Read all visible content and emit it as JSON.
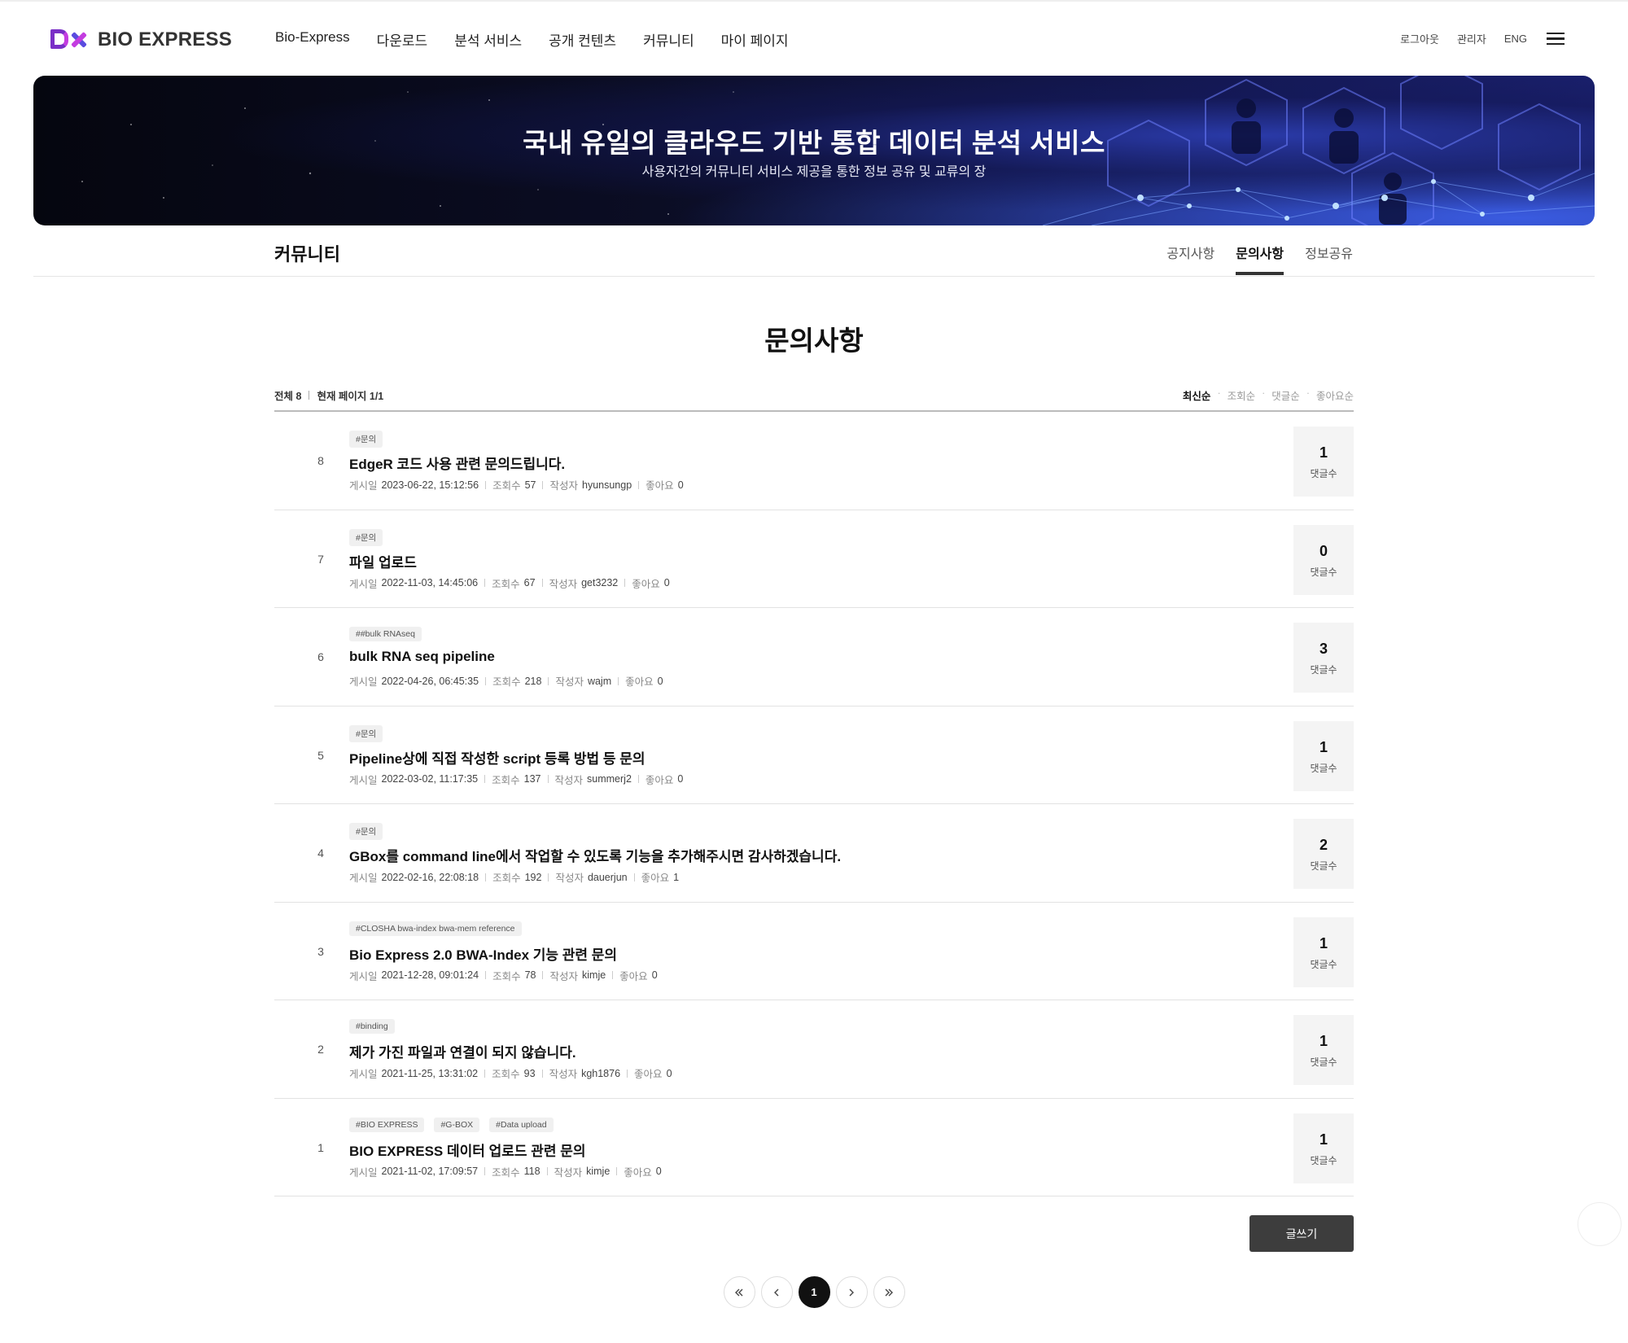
{
  "header": {
    "brand": "BIO EXPRESS",
    "nav": [
      "Bio-Express",
      "다운로드",
      "분석 서비스",
      "공개 컨텐츠",
      "커뮤니티",
      "마이 페이지"
    ],
    "util": [
      "로그아웃",
      "관리자",
      "ENG"
    ]
  },
  "banner": {
    "title": "국내 유일의 클라우드 기반 통합 데이터 분석 서비스",
    "subtitle": "사용자간의 커뮤니티 서비스 제공을 통한 정보 공유 및 교류의 장"
  },
  "subnav": {
    "title": "커뮤니티",
    "tabs": [
      "공지사항",
      "문의사항",
      "정보공유"
    ],
    "active_tab": "문의사항"
  },
  "board": {
    "title": "문의사항",
    "total_label": "전체 8",
    "page_label": "현재 페이지 1/1",
    "sort_options": [
      "최신순",
      "조회순",
      "댓글순",
      "좋아요순"
    ],
    "meta_labels": {
      "date": "게시일",
      "views": "조회수",
      "author": "작성자",
      "likes": "좋아요"
    },
    "comment_label": "댓글수",
    "posts": [
      {
        "num": "8",
        "tags": [
          "#문의"
        ],
        "title": "EdgeR 코드 사용 관련 문의드립니다.",
        "date": "2023-06-22, 15:12:56",
        "views": "57",
        "author": "hyunsungp",
        "likes": "0",
        "comments": "1"
      },
      {
        "num": "7",
        "tags": [
          "#문의"
        ],
        "title": "파일 업로드",
        "date": "2022-11-03, 14:45:06",
        "views": "67",
        "author": "get3232",
        "likes": "0",
        "comments": "0"
      },
      {
        "num": "6",
        "tags": [
          "##bulk RNAseq"
        ],
        "title": "bulk RNA seq pipeline",
        "date": "2022-04-26, 06:45:35",
        "views": "218",
        "author": "wajm",
        "likes": "0",
        "comments": "3"
      },
      {
        "num": "5",
        "tags": [
          "#문의"
        ],
        "title": "Pipeline상에 직접 작성한 script 등록 방법 등 문의",
        "date": "2022-03-02, 11:17:35",
        "views": "137",
        "author": "summerj2",
        "likes": "0",
        "comments": "1"
      },
      {
        "num": "4",
        "tags": [
          "#문의"
        ],
        "title": "GBox를 command line에서 작업할 수 있도록 기능을 추가해주시면 감사하겠습니다.",
        "date": "2022-02-16, 22:08:18",
        "views": "192",
        "author": "dauerjun",
        "likes": "1",
        "comments": "2"
      },
      {
        "num": "3",
        "tags": [
          "#CLOSHA bwa-index bwa-mem reference"
        ],
        "title": "Bio Express 2.0 BWA-Index 기능 관련 문의",
        "date": "2021-12-28, 09:01:24",
        "views": "78",
        "author": "kimje",
        "likes": "0",
        "comments": "1"
      },
      {
        "num": "2",
        "tags": [
          "#binding"
        ],
        "title": "제가 가진 파일과 연결이 되지 않습니다.",
        "date": "2021-11-25, 13:31:02",
        "views": "93",
        "author": "kgh1876",
        "likes": "0",
        "comments": "1"
      },
      {
        "num": "1",
        "tags": [
          "#BIO EXPRESS",
          "#G-BOX",
          "#Data upload"
        ],
        "title": "BIO EXPRESS 데이터 업로드 관련 문의",
        "date": "2021-11-02, 17:09:57",
        "views": "118",
        "author": "kimje",
        "likes": "0",
        "comments": "1"
      }
    ],
    "write_label": "글쓰기"
  },
  "pagination": {
    "current": "1"
  }
}
